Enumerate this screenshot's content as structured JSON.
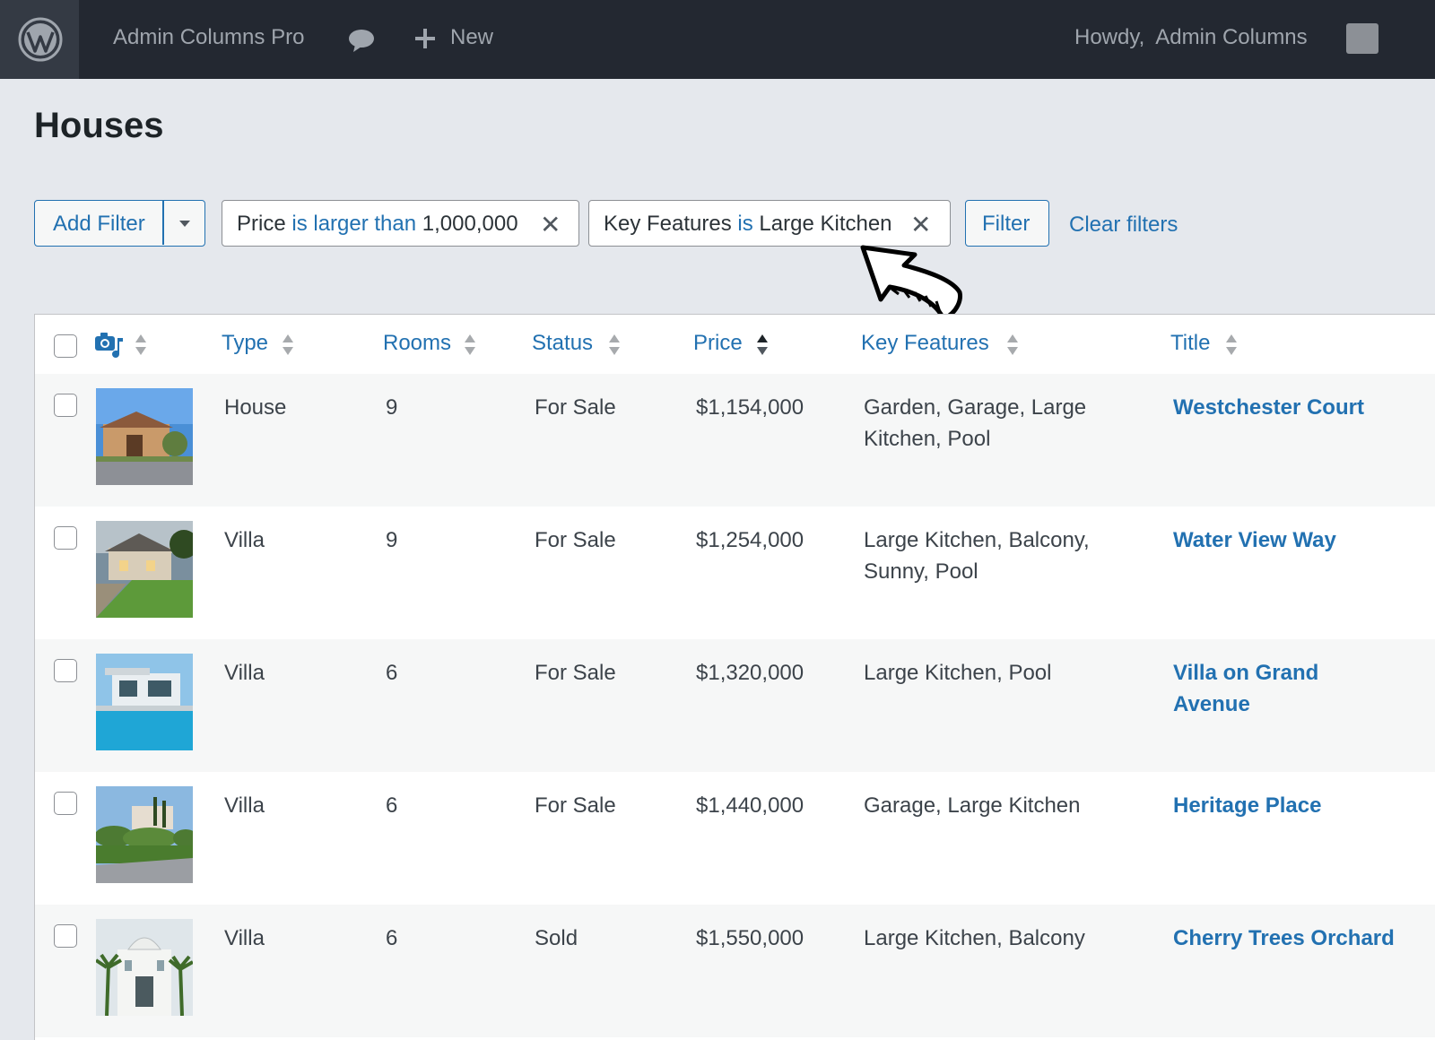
{
  "admin_bar": {
    "site_name": "Admin Columns Pro",
    "new_label": "New",
    "howdy_label": "Howdy,  Admin Columns",
    "icons": [
      "wordpress-logo-icon",
      "comment-icon",
      "plus-icon"
    ]
  },
  "page": {
    "title": "Houses"
  },
  "filters": {
    "add_filter_label": "Add Filter",
    "chips": [
      {
        "field": "Price",
        "operator": "is larger than",
        "value": "1,000,000",
        "remove": "✕"
      },
      {
        "field": "Key Features",
        "operator": "is",
        "value": "Large Kitchen",
        "remove": "✕"
      }
    ],
    "filter_button": "Filter",
    "clear_filters": "Clear filters"
  },
  "table": {
    "columns": [
      "Type",
      "Rooms",
      "Status",
      "Price",
      "Key Features",
      "Title"
    ],
    "sorted_column": "Price",
    "sort_direction": "ascending",
    "rows": [
      {
        "type": "House",
        "rooms": "9",
        "status": "For Sale",
        "price": "$1,154,000",
        "features": "Garden, Garage, Large Kitchen, Pool",
        "title": "Westchester Court"
      },
      {
        "type": "Villa",
        "rooms": "9",
        "status": "For Sale",
        "price": "$1,254,000",
        "features": "Large Kitchen, Balcony, Sunny, Pool",
        "title": "Water View Way"
      },
      {
        "type": "Villa",
        "rooms": "6",
        "status": "For Sale",
        "price": "$1,320,000",
        "features": "Large Kitchen, Pool",
        "title": "Villa on Grand Avenue"
      },
      {
        "type": "Villa",
        "rooms": "6",
        "status": "For Sale",
        "price": "$1,440,000",
        "features": "Garage, Large Kitchen",
        "title": "Heritage Place"
      },
      {
        "type": "Villa",
        "rooms": "6",
        "status": "Sold",
        "price": "$1,550,000",
        "features": "Large Kitchen, Balcony",
        "title": "Cherry Trees Orchard"
      }
    ]
  },
  "colors": {
    "accent": "#2271b1",
    "admin_bar": "#232831",
    "background": "#e5e8ed"
  }
}
